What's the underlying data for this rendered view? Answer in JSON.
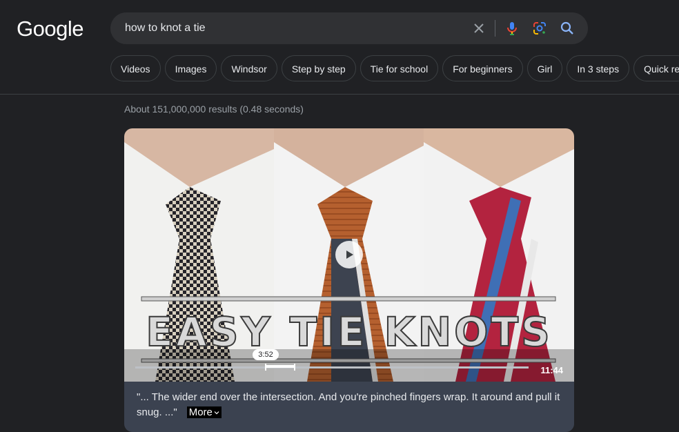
{
  "logo": "Google",
  "search": {
    "query": "how to knot a tie"
  },
  "icons": {
    "clear": "close-icon",
    "mic": "microphone-icon",
    "lens": "google-lens-icon",
    "search": "search-icon",
    "play": "play-icon",
    "more_chevron": "chevron-down-icon"
  },
  "chips": [
    "Videos",
    "Images",
    "Windsor",
    "Step by step",
    "Tie for school",
    "For beginners",
    "Girl",
    "In 3 steps",
    "Quick re"
  ],
  "stats": "About 151,000,000 results (0.48 seconds)",
  "video": {
    "title_overlay": "EASY TIE KNOTS",
    "timestamp": "3:52",
    "duration": "11:44",
    "segment_start_fraction": 0.33,
    "segment_end_fraction": 0.4,
    "snippet": "\"... The wider end over the intersection. And you're pinched fingers wrap. It around and pull it snug. ...\"",
    "more_label": "More"
  },
  "colors": {
    "background": "#202124",
    "search_bg": "#303134",
    "chip_border": "#3c4043",
    "muted_text": "#9aa0a6",
    "search_blue": "#8ab4f8",
    "snippet_bg": "#3b4250"
  }
}
